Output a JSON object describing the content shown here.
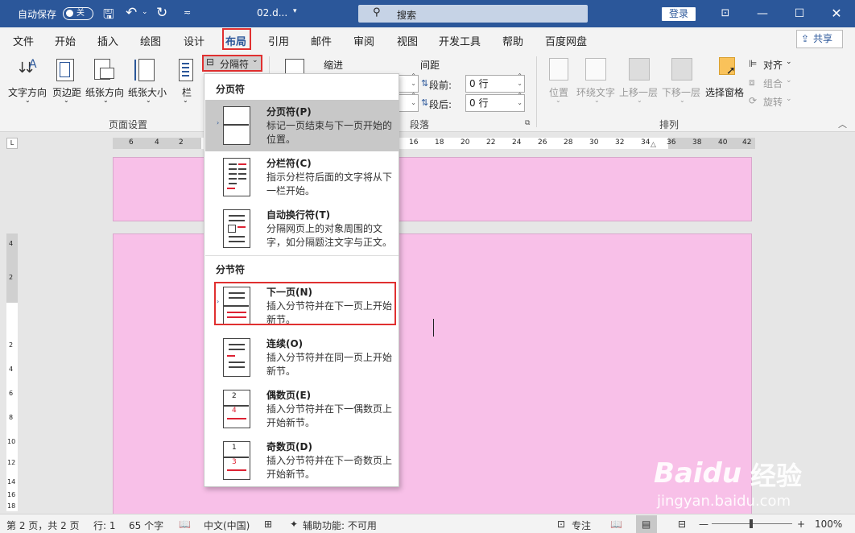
{
  "titlebar": {
    "autosave_label": "自动保存",
    "autosave_state": "关",
    "doc_name": "02.d...",
    "search_placeholder": "搜索",
    "login": "登录"
  },
  "tabs": [
    "文件",
    "开始",
    "插入",
    "绘图",
    "设计",
    "布局",
    "引用",
    "邮件",
    "审阅",
    "视图",
    "开发工具",
    "帮助",
    "百度网盘"
  ],
  "active_tab": "布局",
  "share": "共享",
  "ribbon": {
    "page_setup": {
      "text_direction": "文字方向",
      "margins": "页边距",
      "orientation": "纸张方向",
      "size": "纸张大小",
      "columns": "栏",
      "breaks": "分隔符",
      "group_label": "页面设置"
    },
    "paragraph": {
      "indent_label": "缩进",
      "spacing_label": "间距",
      "before_label": "段前:",
      "before_value": "0 行",
      "after_label": "段后:",
      "after_value": "0 行",
      "group_label": "段落"
    },
    "arrange": {
      "position": "位置",
      "wrap_text": "环绕文字",
      "bring_forward": "上移一层",
      "send_backward": "下移一层",
      "selection_pane": "选择窗格",
      "align": "对齐",
      "group": "组合",
      "rotate": "旋转",
      "group_label": "排列"
    }
  },
  "menu": {
    "section_page": "分页符",
    "section_section": "分节符",
    "items": [
      {
        "title": "分页符(P)",
        "desc": "标记一页结束与下一页开始的位置。"
      },
      {
        "title": "分栏符(C)",
        "desc": "指示分栏符后面的文字将从下一栏开始。"
      },
      {
        "title": "自动换行符(T)",
        "desc": "分隔网页上的对象周围的文字，如分隔题注文字与正文。"
      },
      {
        "title": "下一页(N)",
        "desc": "插入分节符并在下一页上开始新节。"
      },
      {
        "title": "连续(O)",
        "desc": "插入分节符并在同一页上开始新节。"
      },
      {
        "title": "偶数页(E)",
        "desc": "插入分节符并在下一偶数页上开始新节。"
      },
      {
        "title": "奇数页(D)",
        "desc": "插入分节符并在下一奇数页上开始新节。"
      }
    ]
  },
  "ruler_h_numbers": [
    "6",
    "4",
    "2",
    "16",
    "18",
    "20",
    "22",
    "24",
    "26",
    "28",
    "30",
    "32",
    "34",
    "36",
    "38",
    "40",
    "42"
  ],
  "ruler_v_numbers": [
    "4",
    "2",
    "2",
    "4",
    "6",
    "8",
    "10",
    "12",
    "14",
    "16",
    "18"
  ],
  "status": {
    "page": "第 2 页，共 2 页",
    "line": "行: 1",
    "words": "65 个字",
    "language": "中文(中国)",
    "accessibility": "辅助功能: 不可用",
    "focus": "专注",
    "zoom": "100%"
  },
  "watermark": {
    "brand": "Baidu",
    "brand_cn": "经验",
    "url": "jingyan.baidu.com"
  }
}
